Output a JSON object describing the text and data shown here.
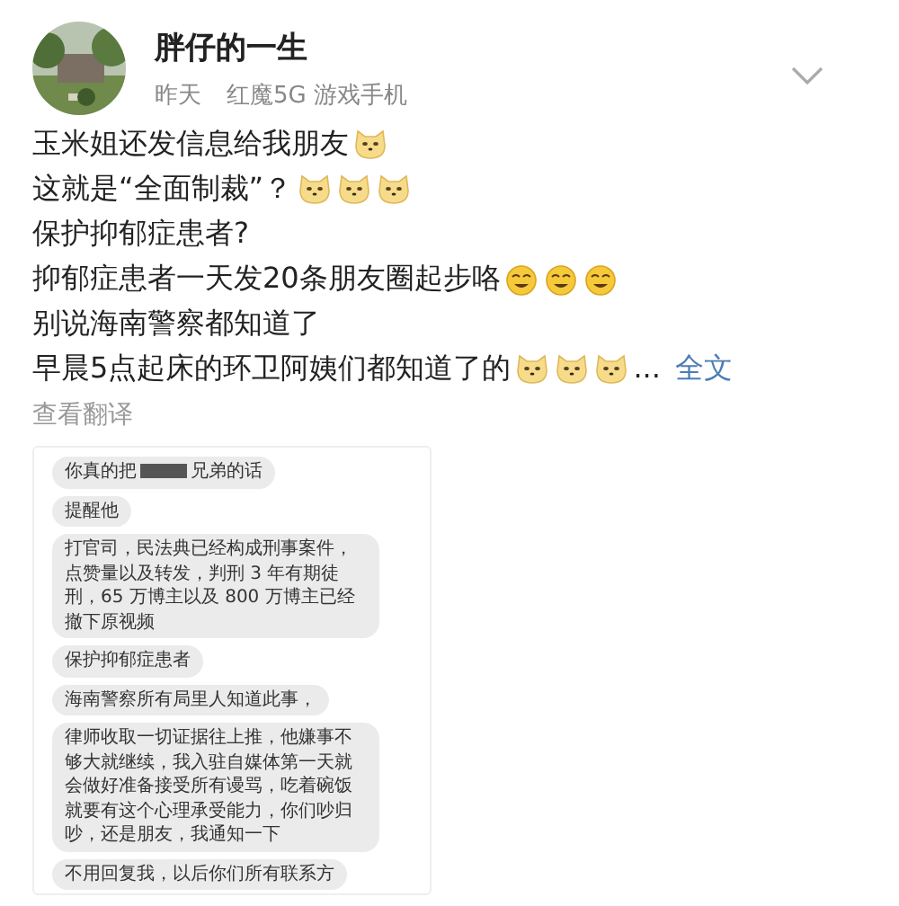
{
  "post": {
    "author": "胖仔的一生",
    "time": "昨天",
    "device": "红魔5G 游戏手机",
    "lines": [
      {
        "text": "玉米姐还发信息给我朋友",
        "emojis": [
          {
            "kind": "doge"
          }
        ]
      },
      {
        "text": "这就是“全面制裁”？",
        "emojis": [
          {
            "kind": "doge"
          },
          {
            "kind": "doge"
          },
          {
            "kind": "doge"
          }
        ]
      },
      {
        "text": "保护抑郁症患者?"
      },
      {
        "text": "抑郁症患者一天发20条朋友圈起步咯",
        "emojis": [
          {
            "kind": "dizzy"
          },
          {
            "kind": "dizzy"
          },
          {
            "kind": "dizzy"
          }
        ]
      },
      {
        "text": "别说海南警察都知道了"
      },
      {
        "text": "早晨5点起床的环卫阿姨们都知道了的",
        "emojis": [
          {
            "kind": "doge"
          },
          {
            "kind": "doge"
          },
          {
            "kind": "doge"
          }
        ],
        "ellipsis": "...",
        "more": "全文"
      }
    ],
    "translate": "查看翻译"
  },
  "chat": {
    "bubbles": [
      {
        "text": "你真的把",
        "redacted": true,
        "text_after": "兄弟的话"
      },
      {
        "text": "提醒他"
      },
      {
        "text": "打官司，民法典已经构成刑事案件，点赞量以及转发，判刑 3 年有期徒刑，65 万博主以及 800 万博主已经撤下原视频"
      },
      {
        "text": "保护抑郁症患者"
      },
      {
        "text": "海南警察所有局里人知道此事，"
      },
      {
        "text": "律师收取一切证据往上推，他嫌事不够大就继续，我入驻自媒体第一天就会做好准备接受所有谩骂，吃着碗饭就要有这个心理承受能力，你们吵归吵，还是朋友，我通知一下"
      },
      {
        "text": "不用回复我，以后你们所有联系方"
      }
    ]
  }
}
